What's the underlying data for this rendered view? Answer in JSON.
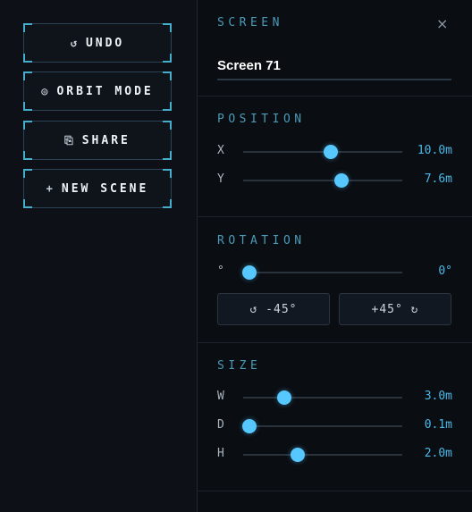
{
  "actions": [
    {
      "icon": "↺",
      "icon_name": "undo-icon",
      "label": "UNDO"
    },
    {
      "icon": "◎",
      "icon_name": "orbit-icon",
      "label": "ORBIT MODE"
    },
    {
      "icon": "⎘",
      "icon_name": "share-icon",
      "label": "SHARE"
    },
    {
      "icon": "+",
      "icon_name": "plus-icon",
      "label": "NEW SCENE"
    }
  ],
  "panel": {
    "title": "SCREEN",
    "close_icon": "×",
    "name_value": "Screen 71"
  },
  "position": {
    "title": "POSITION",
    "x": {
      "label": "X",
      "value": "10.0m",
      "fraction": 0.55
    },
    "y": {
      "label": "Y",
      "value": "7.6m",
      "fraction": 0.62
    }
  },
  "rotation": {
    "title": "ROTATION",
    "label": "°",
    "value": "0°",
    "fraction": 0.04,
    "minus_label": "↺ -45°",
    "plus_label": "+45° ↻"
  },
  "size": {
    "title": "SIZE",
    "w": {
      "label": "W",
      "value": "3.0m",
      "fraction": 0.26
    },
    "d": {
      "label": "D",
      "value": "0.1m",
      "fraction": 0.04
    },
    "h": {
      "label": "H",
      "value": "2.0m",
      "fraction": 0.34
    }
  },
  "colors": {
    "accent": "#56c7ff",
    "section_title": "#4a9ab8",
    "value": "#4ab9e8"
  }
}
